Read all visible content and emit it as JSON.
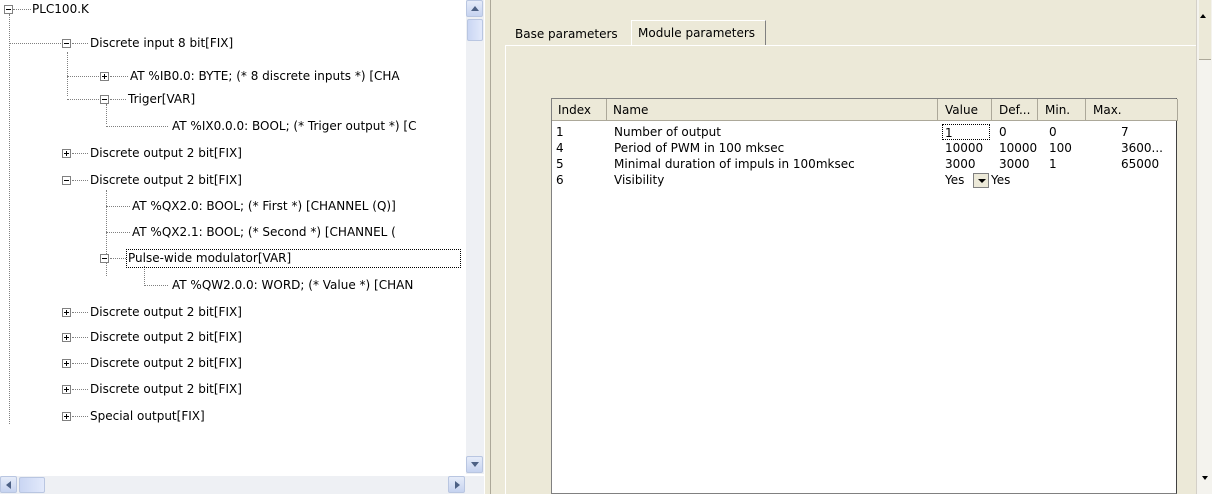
{
  "tree": {
    "nodes": [
      {
        "label": "PLC100.K",
        "icon": "collapse-box-icon"
      },
      {
        "label": "Discrete input 8 bit[FIX]",
        "icon": "collapse-box-icon"
      },
      {
        "label": "AT %IB0.0: BYTE; (* 8 discrete inputs *) [CHA",
        "icon": "expand-box-icon"
      },
      {
        "label": "Triger[VAR]",
        "icon": "collapse-box-icon"
      },
      {
        "label": "AT %IX0.0.0: BOOL; (* Triger output *) [C",
        "icon": ""
      },
      {
        "label": "Discrete output 2 bit[FIX]",
        "icon": "expand-box-icon"
      },
      {
        "label": "Discrete output 2 bit[FIX]",
        "icon": "collapse-box-icon"
      },
      {
        "label": "AT %QX2.0: BOOL; (* First *) [CHANNEL (Q)]",
        "icon": ""
      },
      {
        "label": "AT %QX2.1: BOOL; (* Second *) [CHANNEL (",
        "icon": ""
      },
      {
        "label": "Pulse-wide modulator[VAR]",
        "icon": "collapse-box-icon"
      },
      {
        "label": "AT %QW2.0.0: WORD; (* Value *) [CHAN",
        "icon": ""
      },
      {
        "label": "Discrete output 2 bit[FIX]",
        "icon": "expand-box-icon"
      },
      {
        "label": "Discrete output 2 bit[FIX]",
        "icon": "expand-box-icon"
      },
      {
        "label": "Discrete output 2 bit[FIX]",
        "icon": "expand-box-icon"
      },
      {
        "label": "Discrete output 2 bit[FIX]",
        "icon": "expand-box-icon"
      },
      {
        "label": "Special output[FIX]",
        "icon": "expand-box-icon"
      }
    ]
  },
  "tabs": [
    {
      "label": "Base parameters"
    },
    {
      "label": "Module parameters"
    }
  ],
  "table": {
    "columns": [
      "Index",
      "Name",
      "Value",
      "Def...",
      "Min.",
      "Max."
    ],
    "rows": [
      {
        "index": "1",
        "name": "Number of output",
        "value": "1",
        "def": "0",
        "min": "0",
        "max": "7"
      },
      {
        "index": "4",
        "name": "Period of PWM in 100 mksec",
        "value": "10000",
        "def": "10000",
        "min": "100",
        "max": "3600..."
      },
      {
        "index": "5",
        "name": "Minimal duration of impuls in 100mksec",
        "value": "3000",
        "def": "3000",
        "min": "1",
        "max": "65000"
      },
      {
        "index": "6",
        "name": "Visibility",
        "value": "Yes",
        "def": "Yes",
        "min": "",
        "max": ""
      }
    ],
    "visibility_combo_icon": "dropdown-arrow-icon"
  },
  "colors": {
    "window_bg": "#ece9d8",
    "scroll_accent": "#c6d3f0"
  }
}
